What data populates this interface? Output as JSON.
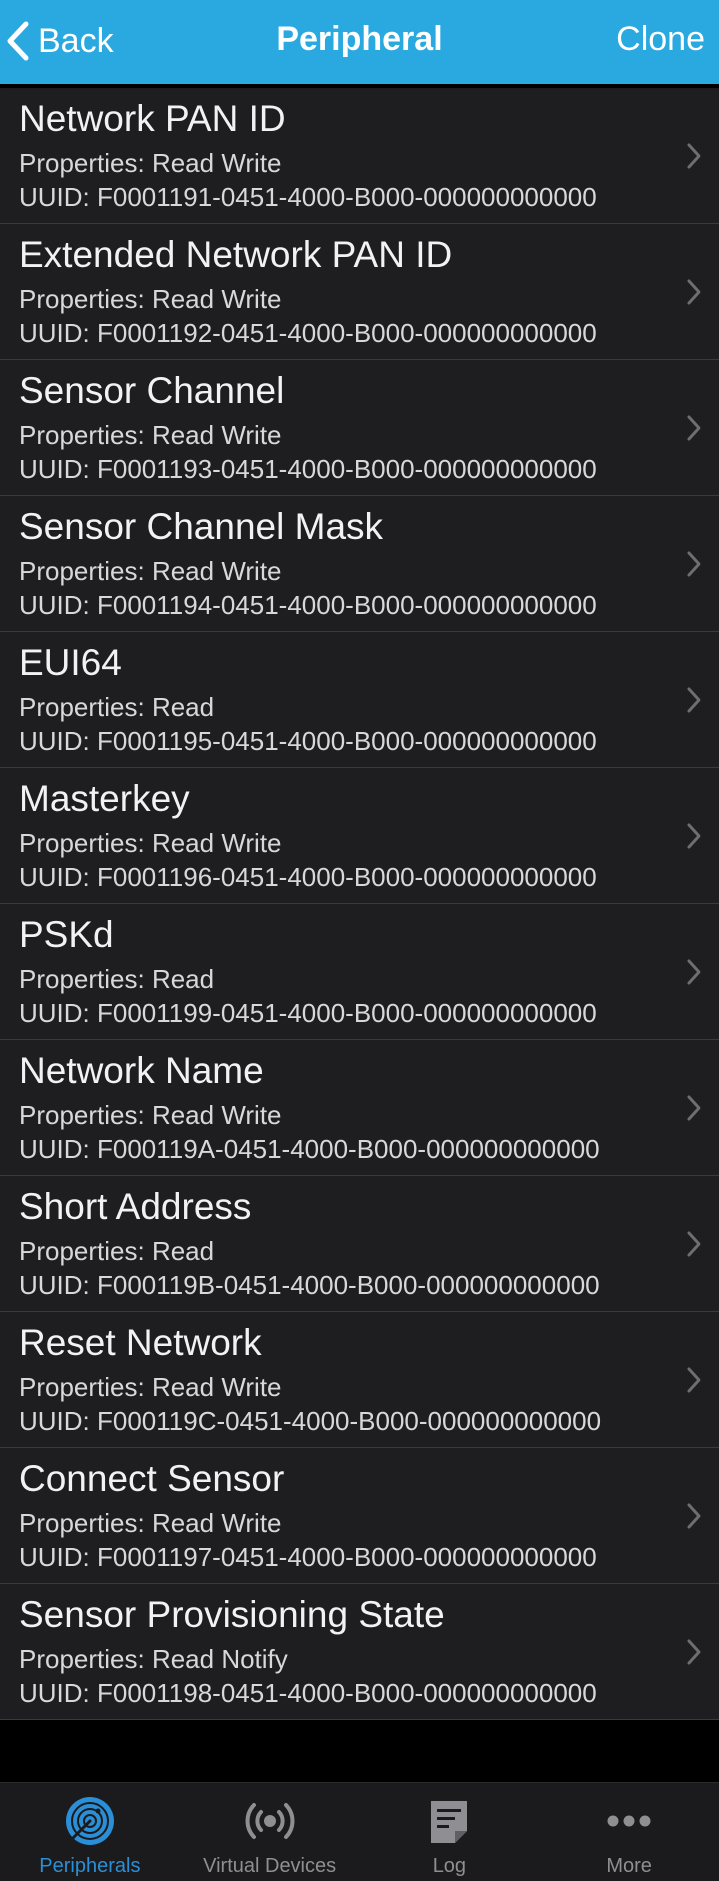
{
  "nav": {
    "back_label": "Back",
    "title": "Peripheral",
    "clone_label": "Clone",
    "accent": "#2aa9e0"
  },
  "characteristics": [
    {
      "name": "Network PAN ID",
      "properties": "Properties: Read Write",
      "uuid": "UUID: F0001191-0451-4000-B000-000000000000"
    },
    {
      "name": "Extended Network PAN ID",
      "properties": "Properties: Read Write",
      "uuid": "UUID: F0001192-0451-4000-B000-000000000000"
    },
    {
      "name": "Sensor Channel",
      "properties": "Properties: Read Write",
      "uuid": "UUID: F0001193-0451-4000-B000-000000000000"
    },
    {
      "name": "Sensor Channel Mask",
      "properties": "Properties: Read Write",
      "uuid": "UUID: F0001194-0451-4000-B000-000000000000"
    },
    {
      "name": "EUI64",
      "properties": "Properties: Read",
      "uuid": "UUID: F0001195-0451-4000-B000-000000000000"
    },
    {
      "name": "Masterkey",
      "properties": "Properties: Read Write",
      "uuid": "UUID: F0001196-0451-4000-B000-000000000000"
    },
    {
      "name": "PSKd",
      "properties": "Properties: Read",
      "uuid": "UUID: F0001199-0451-4000-B000-000000000000"
    },
    {
      "name": "Network Name",
      "properties": "Properties: Read Write",
      "uuid": "UUID: F000119A-0451-4000-B000-000000000000"
    },
    {
      "name": "Short Address",
      "properties": "Properties: Read",
      "uuid": "UUID: F000119B-0451-4000-B000-000000000000"
    },
    {
      "name": "Reset Network",
      "properties": "Properties: Read Write",
      "uuid": "UUID: F000119C-0451-4000-B000-000000000000"
    },
    {
      "name": "Connect Sensor",
      "properties": "Properties: Read Write",
      "uuid": "UUID: F0001197-0451-4000-B000-000000000000"
    },
    {
      "name": "Sensor Provisioning State",
      "properties": "Properties: Read Notify",
      "uuid": "UUID: F0001198-0451-4000-B000-000000000000"
    }
  ],
  "tabbar": {
    "active_color": "#2a8fd6",
    "inactive_color": "#8e8e93",
    "tabs": [
      {
        "label": "Peripherals",
        "icon": "radar-icon",
        "active": true
      },
      {
        "label": "Virtual Devices",
        "icon": "broadcast-icon",
        "active": false
      },
      {
        "label": "Log",
        "icon": "log-icon",
        "active": false
      },
      {
        "label": "More",
        "icon": "more-icon",
        "active": false
      }
    ]
  }
}
